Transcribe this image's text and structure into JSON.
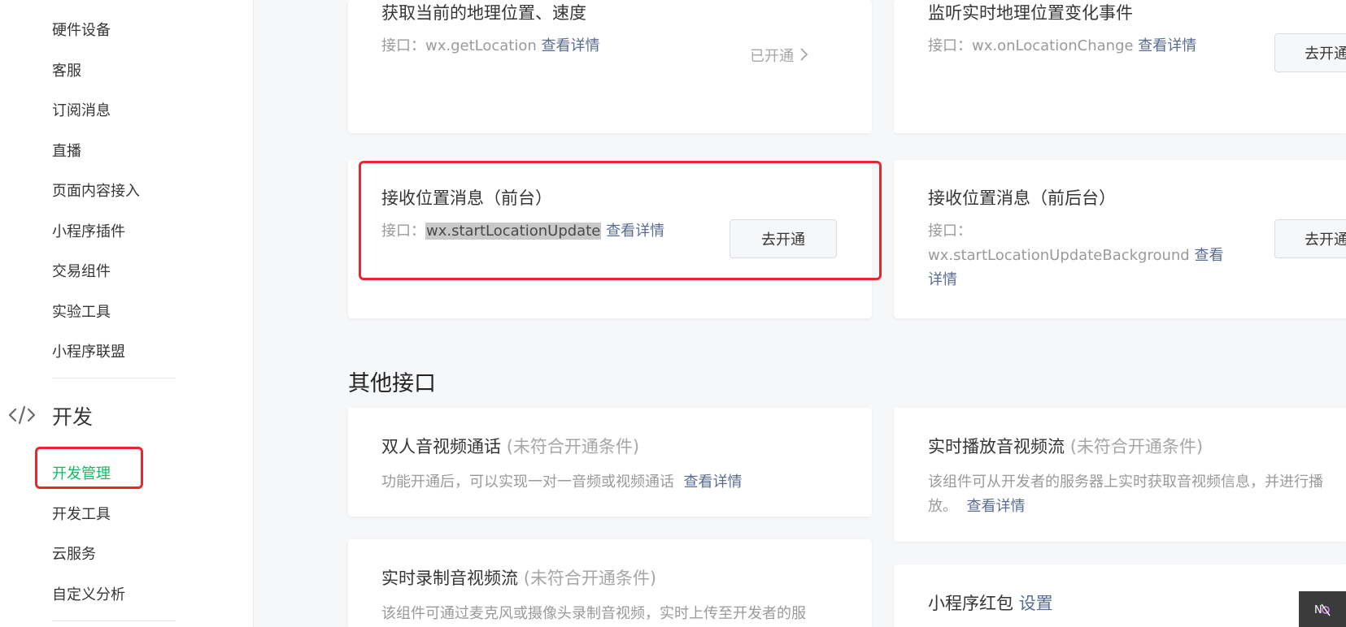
{
  "sidebar": {
    "items_top": [
      "硬件设备",
      "客服",
      "订阅消息",
      "直播",
      "页面内容接入",
      "小程序插件",
      "交易组件",
      "实验工具",
      "小程序联盟"
    ],
    "section_icon": "code-icon",
    "section_title": "开发",
    "items_dev": [
      "开发管理",
      "开发工具",
      "云服务",
      "自定义分析"
    ],
    "active_item": "开发管理"
  },
  "cards": {
    "get_location": {
      "title": "获取当前的地理位置、速度",
      "api_prefix": "接口：",
      "api": "wx.getLocation",
      "link": "查看详情",
      "status": "已开通",
      "status_icon": "chevron-right-icon"
    },
    "on_location_change": {
      "title": "监听实时地理位置变化事件",
      "api_prefix": "接口：",
      "api": "wx.onLocationChange",
      "link": "查看详情",
      "button": "去开通"
    },
    "location_update_fg": {
      "title": "接收位置消息（前台）",
      "api_prefix": "接口：",
      "api": "wx.startLocationUpdate",
      "link": "查看详情",
      "button": "去开通"
    },
    "location_update_bg": {
      "title": "接收位置消息（前后台）",
      "api_prefix": "接口：",
      "api": "wx.startLocationUpdateBackground",
      "link_part1": "查看",
      "link_part2": "详情",
      "button": "去开通"
    }
  },
  "other": {
    "heading": "其他接口",
    "dual_av": {
      "title": "双人音视频通话",
      "condition": "(未符合开通条件)",
      "desc": "功能开通后，可以实现一对一音频或视频通话",
      "link": "查看详情"
    },
    "live_play": {
      "title": "实时播放音视频流",
      "condition": "(未符合开通条件)",
      "desc_line1": "该组件可从开发者的服务器上实时获取音视频信息，并进行播",
      "desc_line2": "放。",
      "link": "查看详情"
    },
    "live_push": {
      "title": "实时录制音视频流",
      "condition": "(未符合开通条件)",
      "desc": "该组件可通过麦克风或摄像头录制音视频，实时上传至开发者的服"
    },
    "red_packet": {
      "title": "小程序红包",
      "link": "设置"
    }
  },
  "corner_widget": {
    "icon": "mute-icon",
    "label": "N"
  },
  "colors": {
    "accent_green": "#07c160",
    "link_blue": "#576b95",
    "highlight_red": "#e9262b"
  }
}
